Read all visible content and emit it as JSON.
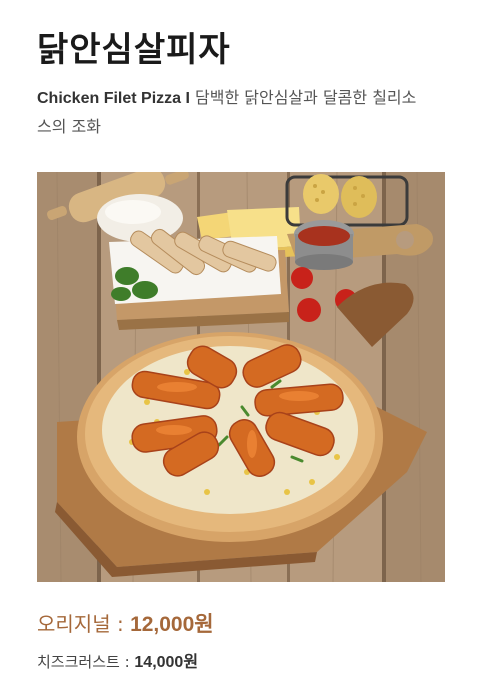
{
  "product": {
    "name": "닭안심살피자",
    "name_en": "Chicken Filet Pizza I",
    "desc_line1": "담백한 닭안심살과 달콤한 칠리소",
    "desc_line2": "스의 조화"
  },
  "prices": {
    "original_label": "오리지널 : ",
    "original_value": "12,000원",
    "cheese_crust_label": "치즈크러스트 : ",
    "cheese_crust_value": "14,000원"
  }
}
